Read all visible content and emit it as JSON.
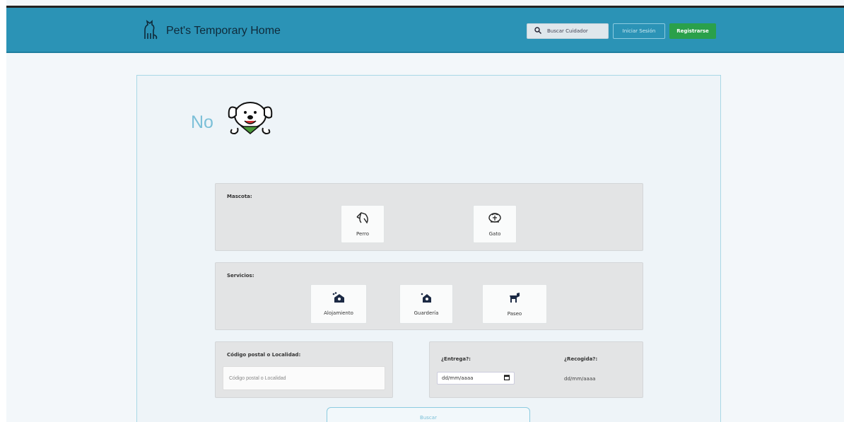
{
  "navbar": {
    "brand": "Pet's Temporary Home",
    "search_label": "Buscar Cuidador",
    "login_label": "Iniciar Sesión",
    "register_label": "Registrarse",
    "brand_icon": "dog-sitting-icon"
  },
  "hero": {
    "text": "No",
    "logo_icon": "happy-dog-icon"
  },
  "mascota": {
    "label": "Mascota:",
    "options": [
      {
        "label": "Perro",
        "icon": "dog-head-icon"
      },
      {
        "label": "Gato",
        "icon": "cat-icon"
      }
    ]
  },
  "servicios": {
    "label": "Servicios:",
    "options": [
      {
        "label": "Alojamiento",
        "icon": "house-paw-icon"
      },
      {
        "label": "Guardería",
        "icon": "house-paw-small-icon"
      },
      {
        "label": "Paseo",
        "icon": "dog-walk-icon"
      }
    ]
  },
  "location": {
    "label": "Código postal o Localidad:",
    "placeholder": "Código postal o Localidad"
  },
  "dates": {
    "entrega_label": "¿Entrega?:",
    "entrega_value": "dd/mm/aaaa",
    "recogida_label": "¿Recogida?:",
    "recogida_value": "dd/mm/aaaa"
  },
  "submit_label": "Buscar",
  "colors": {
    "navbar": "#2b93b6",
    "register": "#2aa04a",
    "accent": "#7cc0d8"
  }
}
